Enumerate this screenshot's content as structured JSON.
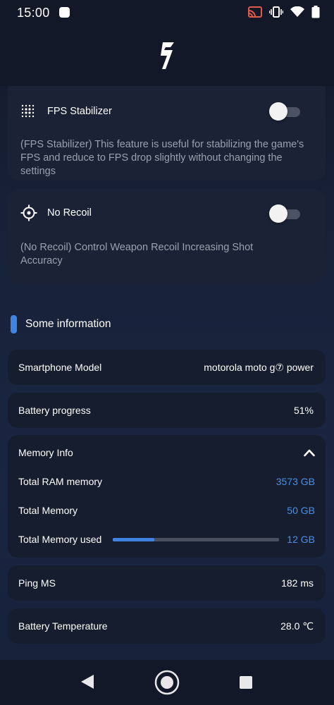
{
  "status_bar": {
    "time": "15:00",
    "icons": [
      "notification-dot-icon",
      "cast-icon",
      "vibrate-icon",
      "wifi-icon",
      "battery-icon"
    ]
  },
  "header": {
    "logo_icon": "app-logo-icon"
  },
  "features": [
    {
      "title": "FPS Stabilizer",
      "icon": "dot-grid-icon",
      "description": "(FPS Stabilizer) This feature is useful for stabilizing the game's FPS and reduce to FPS drop slightly without changing the settings",
      "enabled": false
    },
    {
      "title": "No Recoil",
      "icon": "crosshair-icon",
      "description": "(No Recoil) Control Weapon Recoil Increasing Shot Accuracy",
      "enabled": false
    }
  ],
  "info_section": {
    "title": "Some information",
    "smartphone_model": {
      "label": "Smartphone Model",
      "value": "motorola moto g⑦ power"
    },
    "battery_progress": {
      "label": "Battery progress",
      "value": "51%"
    },
    "memory_info": {
      "title": "Memory Info",
      "total_ram": {
        "label": "Total RAM memory",
        "value": "3573 GB"
      },
      "total_memory": {
        "label": "Total Memory",
        "value": "50 GB"
      },
      "memory_used": {
        "label": "Total Memory used",
        "value": "12 GB",
        "fraction": 0.25
      }
    },
    "ping": {
      "label": "Ping MS",
      "value": "182 ms"
    },
    "battery_temperature": {
      "label": "Battery Temperature",
      "value": "28.0 ℃"
    }
  },
  "colors": {
    "accent": "#3f84e0",
    "value_blue": "#4a8fe6",
    "card_bg": "#1b2235",
    "row_bg": "#161d2e",
    "muted_text": "#9aa0ad"
  }
}
